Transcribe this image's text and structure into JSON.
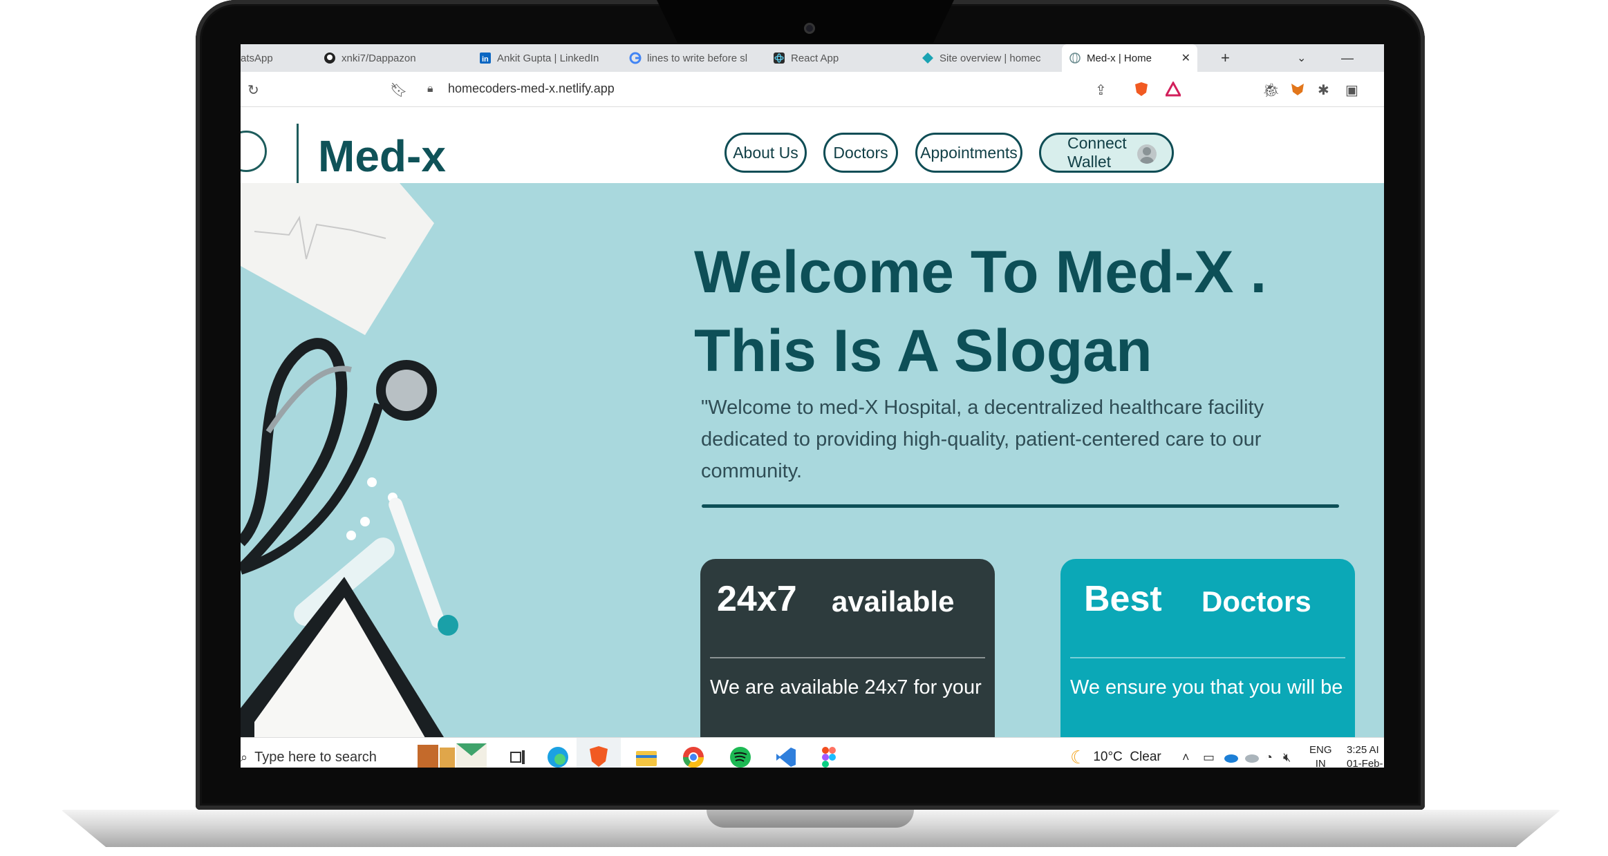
{
  "browser": {
    "tabs": [
      {
        "label": "atsApp",
        "icon": "whatsapp-icon"
      },
      {
        "label": "xnki7/Dappazon",
        "icon": "github-icon"
      },
      {
        "label": "Ankit Gupta | LinkedIn",
        "icon": "linkedin-icon"
      },
      {
        "label": "lines to write before sl",
        "icon": "google-icon"
      },
      {
        "label": "React App",
        "icon": "react-icon"
      },
      {
        "label": "Site overview | homec",
        "icon": "netlify-icon"
      },
      {
        "label": "Med-x | Home",
        "icon": "globe-icon",
        "active": true
      }
    ],
    "new_tab": "+",
    "close": "✕",
    "url": "homecoders-med-x.netlify.app"
  },
  "site": {
    "brand": "Med-x",
    "nav": {
      "about": "About Us",
      "doctors": "Doctors",
      "appointments": "Appointments",
      "wallet": "Connect Wallet"
    },
    "hero": {
      "title_line1": "Welcome To Med-X .",
      "title_line2": "This Is A Slogan",
      "description": "\"Welcome to med-X Hospital, a decentralized healthcare facility dedicated to providing high-quality, patient-centered care to our community."
    },
    "cards": [
      {
        "title_a": "24x7",
        "title_b": "available",
        "body": "We are available 24x7 for your"
      },
      {
        "title_a": "Best",
        "title_b": "Doctors",
        "body": "We ensure you that you will be"
      }
    ]
  },
  "taskbar": {
    "search_placeholder": "Type here to search",
    "weather": "10°C  Clear",
    "lang_top": "ENG",
    "lang_bottom": "IN",
    "time": "3:25 AI",
    "date": "01-Feb-"
  },
  "colors": {
    "accent": "#0f5258",
    "hero_bg": "#a9d8dd",
    "card_dark": "#2d3b3d",
    "card_teal": "#0ba8b7"
  }
}
